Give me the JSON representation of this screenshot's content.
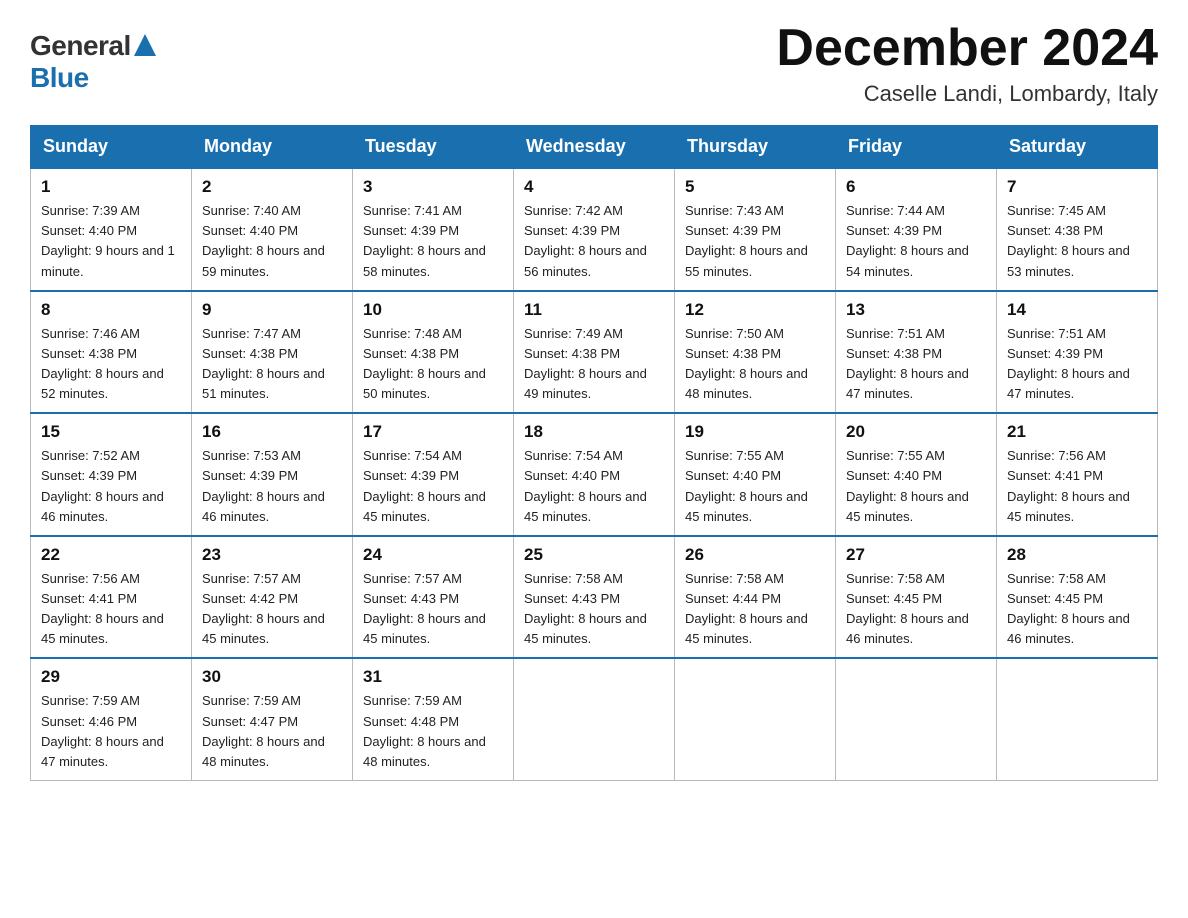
{
  "logo": {
    "general": "General",
    "blue": "Blue"
  },
  "header": {
    "month_year": "December 2024",
    "location": "Caselle Landi, Lombardy, Italy"
  },
  "days_of_week": [
    "Sunday",
    "Monday",
    "Tuesday",
    "Wednesday",
    "Thursday",
    "Friday",
    "Saturday"
  ],
  "weeks": [
    [
      {
        "date": "1",
        "sunrise": "7:39 AM",
        "sunset": "4:40 PM",
        "daylight": "9 hours and 1 minute."
      },
      {
        "date": "2",
        "sunrise": "7:40 AM",
        "sunset": "4:40 PM",
        "daylight": "8 hours and 59 minutes."
      },
      {
        "date": "3",
        "sunrise": "7:41 AM",
        "sunset": "4:39 PM",
        "daylight": "8 hours and 58 minutes."
      },
      {
        "date": "4",
        "sunrise": "7:42 AM",
        "sunset": "4:39 PM",
        "daylight": "8 hours and 56 minutes."
      },
      {
        "date": "5",
        "sunrise": "7:43 AM",
        "sunset": "4:39 PM",
        "daylight": "8 hours and 55 minutes."
      },
      {
        "date": "6",
        "sunrise": "7:44 AM",
        "sunset": "4:39 PM",
        "daylight": "8 hours and 54 minutes."
      },
      {
        "date": "7",
        "sunrise": "7:45 AM",
        "sunset": "4:38 PM",
        "daylight": "8 hours and 53 minutes."
      }
    ],
    [
      {
        "date": "8",
        "sunrise": "7:46 AM",
        "sunset": "4:38 PM",
        "daylight": "8 hours and 52 minutes."
      },
      {
        "date": "9",
        "sunrise": "7:47 AM",
        "sunset": "4:38 PM",
        "daylight": "8 hours and 51 minutes."
      },
      {
        "date": "10",
        "sunrise": "7:48 AM",
        "sunset": "4:38 PM",
        "daylight": "8 hours and 50 minutes."
      },
      {
        "date": "11",
        "sunrise": "7:49 AM",
        "sunset": "4:38 PM",
        "daylight": "8 hours and 49 minutes."
      },
      {
        "date": "12",
        "sunrise": "7:50 AM",
        "sunset": "4:38 PM",
        "daylight": "8 hours and 48 minutes."
      },
      {
        "date": "13",
        "sunrise": "7:51 AM",
        "sunset": "4:38 PM",
        "daylight": "8 hours and 47 minutes."
      },
      {
        "date": "14",
        "sunrise": "7:51 AM",
        "sunset": "4:39 PM",
        "daylight": "8 hours and 47 minutes."
      }
    ],
    [
      {
        "date": "15",
        "sunrise": "7:52 AM",
        "sunset": "4:39 PM",
        "daylight": "8 hours and 46 minutes."
      },
      {
        "date": "16",
        "sunrise": "7:53 AM",
        "sunset": "4:39 PM",
        "daylight": "8 hours and 46 minutes."
      },
      {
        "date": "17",
        "sunrise": "7:54 AM",
        "sunset": "4:39 PM",
        "daylight": "8 hours and 45 minutes."
      },
      {
        "date": "18",
        "sunrise": "7:54 AM",
        "sunset": "4:40 PM",
        "daylight": "8 hours and 45 minutes."
      },
      {
        "date": "19",
        "sunrise": "7:55 AM",
        "sunset": "4:40 PM",
        "daylight": "8 hours and 45 minutes."
      },
      {
        "date": "20",
        "sunrise": "7:55 AM",
        "sunset": "4:40 PM",
        "daylight": "8 hours and 45 minutes."
      },
      {
        "date": "21",
        "sunrise": "7:56 AM",
        "sunset": "4:41 PM",
        "daylight": "8 hours and 45 minutes."
      }
    ],
    [
      {
        "date": "22",
        "sunrise": "7:56 AM",
        "sunset": "4:41 PM",
        "daylight": "8 hours and 45 minutes."
      },
      {
        "date": "23",
        "sunrise": "7:57 AM",
        "sunset": "4:42 PM",
        "daylight": "8 hours and 45 minutes."
      },
      {
        "date": "24",
        "sunrise": "7:57 AM",
        "sunset": "4:43 PM",
        "daylight": "8 hours and 45 minutes."
      },
      {
        "date": "25",
        "sunrise": "7:58 AM",
        "sunset": "4:43 PM",
        "daylight": "8 hours and 45 minutes."
      },
      {
        "date": "26",
        "sunrise": "7:58 AM",
        "sunset": "4:44 PM",
        "daylight": "8 hours and 45 minutes."
      },
      {
        "date": "27",
        "sunrise": "7:58 AM",
        "sunset": "4:45 PM",
        "daylight": "8 hours and 46 minutes."
      },
      {
        "date": "28",
        "sunrise": "7:58 AM",
        "sunset": "4:45 PM",
        "daylight": "8 hours and 46 minutes."
      }
    ],
    [
      {
        "date": "29",
        "sunrise": "7:59 AM",
        "sunset": "4:46 PM",
        "daylight": "8 hours and 47 minutes."
      },
      {
        "date": "30",
        "sunrise": "7:59 AM",
        "sunset": "4:47 PM",
        "daylight": "8 hours and 48 minutes."
      },
      {
        "date": "31",
        "sunrise": "7:59 AM",
        "sunset": "4:48 PM",
        "daylight": "8 hours and 48 minutes."
      },
      null,
      null,
      null,
      null
    ]
  ]
}
